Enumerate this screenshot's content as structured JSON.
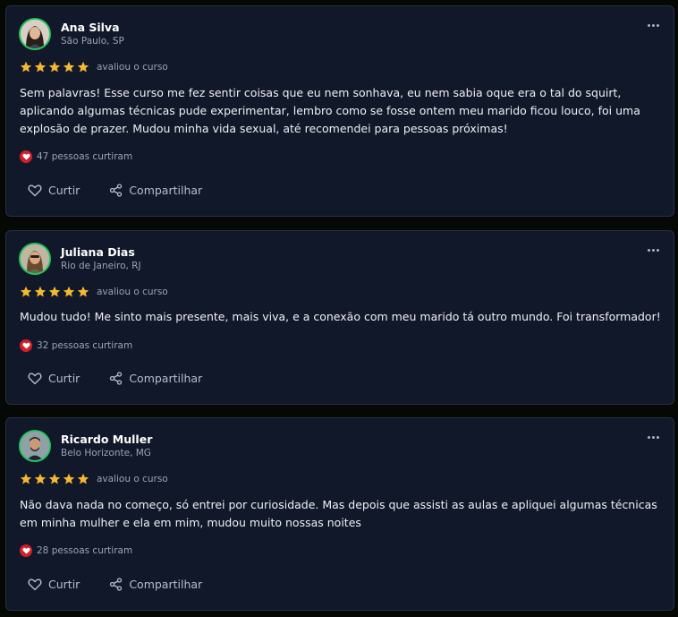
{
  "rating_text": "avaliou o curso",
  "actions": {
    "like_label": "Curtir",
    "share_label": "Compartilhar"
  },
  "colors": {
    "star": "#f5b82e",
    "like_badge": "#d31f2b",
    "avatar_ring": "#22c55e"
  },
  "reviews": [
    {
      "name": "Ana Silva",
      "location": "São Paulo, SP",
      "stars": 5,
      "text": "Sem palavras! Esse curso me fez sentir coisas que eu nem sonhava, eu nem sabia oque era o tal do squirt, aplicando algumas técnicas pude experimentar, lembro como se fosse ontem meu marido ficou louco, foi uma explosão de prazer. Mudou minha vida sexual, até recomendei para pessoas próximas!",
      "likes": "47 pessoas curtiram"
    },
    {
      "name": "Juliana Dias",
      "location": "Rio de Janeiro, RJ",
      "stars": 5,
      "text": "Mudou tudo! Me sinto mais presente, mais viva, e a conexão com meu marido tá outro mundo. Foi transformador!",
      "likes": "32 pessoas curtiram"
    },
    {
      "name": "Ricardo Muller",
      "location": "Belo Horizonte, MG",
      "stars": 5,
      "text": "Não dava nada no começo, só entrei por curiosidade. Mas depois que assisti as aulas e apliquei algumas técnicas em minha mulher e ela em mim, mudou muito nossas noites",
      "likes": "28 pessoas curtiram"
    }
  ]
}
